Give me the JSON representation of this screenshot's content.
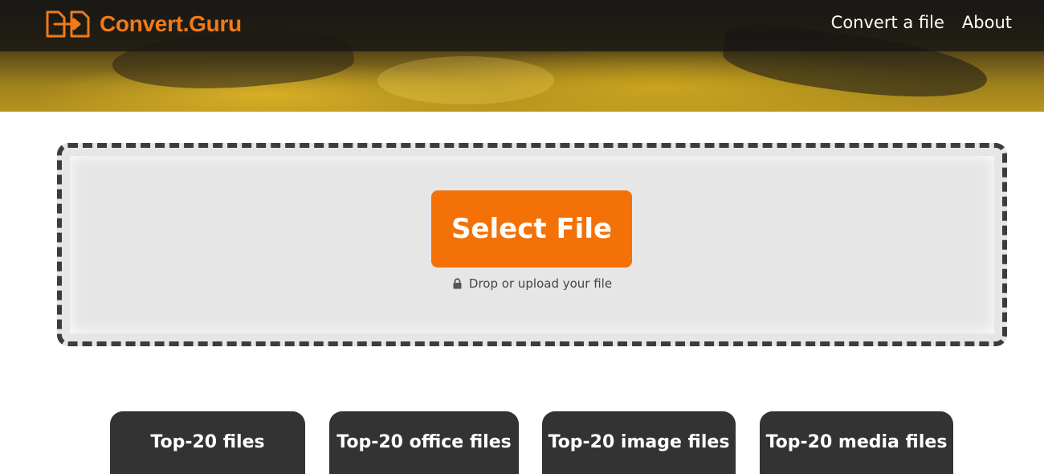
{
  "header": {
    "logo_text": "Convert.Guru",
    "logo_icon": "file-convert-icon",
    "nav": [
      {
        "label": "Convert a file"
      },
      {
        "label": "About"
      }
    ]
  },
  "upload": {
    "select_label": "Select File",
    "hint_icon": "lock-icon",
    "hint": "Drop or upload your file"
  },
  "categories": [
    {
      "label": "Top-20 files"
    },
    {
      "label": "Top-20 office files"
    },
    {
      "label": "Top-20 image files"
    },
    {
      "label": "Top-20 media files"
    }
  ],
  "colors": {
    "accent": "#f37106",
    "topbar": "#141414",
    "tab_bg": "#333333",
    "dropzone_bg": "#e6e6e6"
  }
}
